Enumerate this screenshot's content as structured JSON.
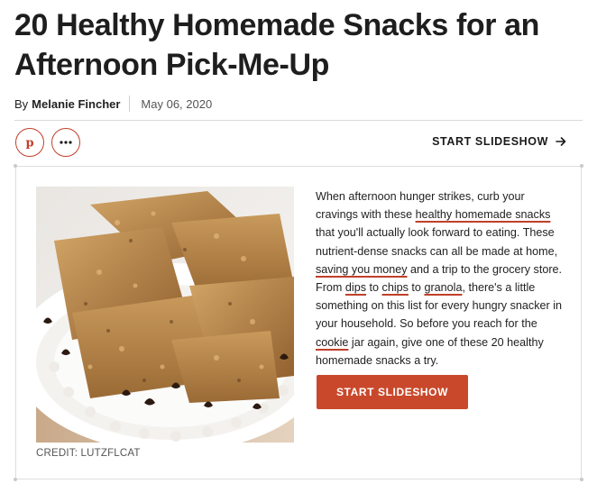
{
  "article": {
    "title": "20 Healthy Homemade Snacks for an Afternoon Pick-Me-Up",
    "byline_prefix": "By",
    "author": "Melanie Fincher",
    "date": "May 06, 2020"
  },
  "share": {
    "pinterest_icon": "pinterest-icon",
    "more_icon": "more-dots-icon"
  },
  "slideshow": {
    "link_label": "START SLIDESHOW",
    "button_label": "START SLIDESHOW",
    "arrow_icon": "arrow-right-icon"
  },
  "image": {
    "subject": "granola bars with chocolate chips on a white plate",
    "credit": "CREDIT: LUTZFLCAT"
  },
  "description": {
    "t1": "When afternoon hunger strikes, curb your cravings with these ",
    "l1": "healthy homemade snacks",
    "t2": " that you'll actually look forward to eating. These nutrient-dense snacks can all be made at home, ",
    "l2": "saving you money",
    "t3": " and a trip to the grocery store. From ",
    "l3": "dips",
    "t4": " to ",
    "l4": "chips",
    "t5": " to ",
    "l5": "granola",
    "t6": ", there's a little something on this list for every hungry snacker in your household. So before you reach for the ",
    "l6": "cookie",
    "t7": " jar again, give one of these 20 healthy homemade snacks a try."
  },
  "colors": {
    "accent": "#c9482b",
    "text": "#1a1a1a",
    "rule": "#d9d9d9"
  }
}
